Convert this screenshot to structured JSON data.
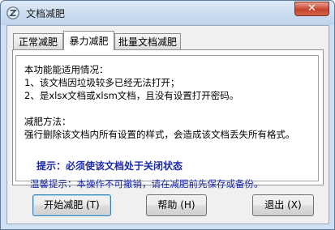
{
  "window": {
    "title": "文档减肥"
  },
  "tabs": [
    {
      "label": "正常减肥",
      "active": false
    },
    {
      "label": "暴力减肥",
      "active": true
    },
    {
      "label": "批量文档减肥",
      "active": false
    }
  ],
  "panel": {
    "applicable_heading": "本功能能适用情况：",
    "case1": "1、该文档因垃圾较多已经无法打开；",
    "case2": "2、是xlsx文档或xlsm文档，且没有设置打开密码。",
    "method_heading": "减肥方法：",
    "method_text": "强行删除该文档内所有设置的样式，会造成该文档丢失所有格式。",
    "hint": "提示：必须使该文档处于关闭状态"
  },
  "warning": "温馨提示：本操作不可撤销，请在减肥前先保存或备份。",
  "buttons": {
    "start": "开始减肥 (T)",
    "help": "帮助 (H)",
    "exit": "退出 (X)"
  },
  "icons": {
    "app": "app-logo-icon",
    "close": "close-icon"
  }
}
